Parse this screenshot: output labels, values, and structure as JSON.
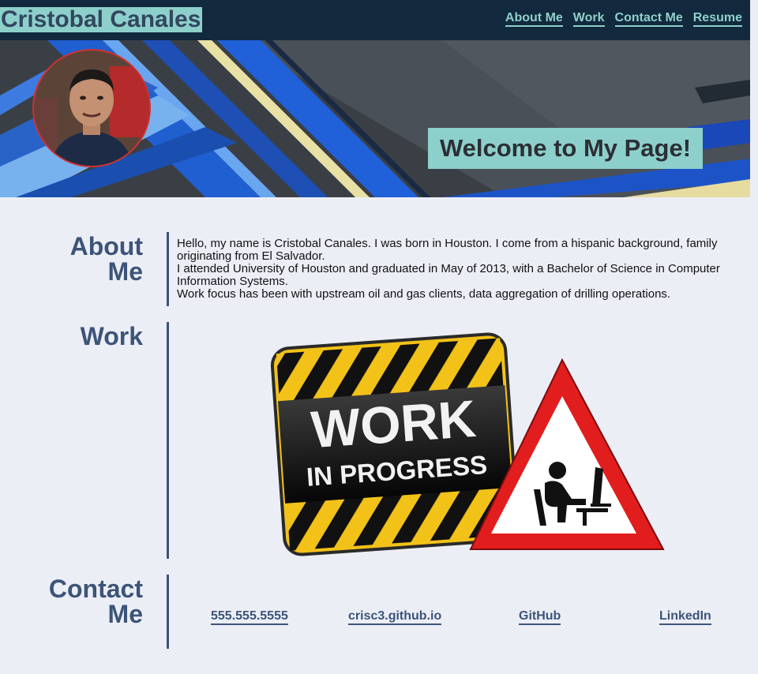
{
  "header": {
    "brand": "Cristobal Canales",
    "nav": [
      "About Me",
      "Work",
      "Contact Me",
      "Resume"
    ]
  },
  "hero": {
    "welcome": "Welcome to My Page!"
  },
  "about": {
    "title_line1": "About",
    "title_line2": "Me",
    "line1": "Hello, my name is Cristobal Canales. I was born in Houston. I come from a hispanic background, family originating from El Salvador.",
    "line2": "I attended University of Houston and graduated in May of 2013, with a Bachelor of Science in Computer Information Systems.",
    "line3": "Work focus has been with upstream oil and gas clients, data aggregation of drilling operations."
  },
  "work": {
    "title": "Work",
    "sign_line1": "WORK",
    "sign_line2": "IN PROGRESS"
  },
  "contact": {
    "title_line1": "Contact",
    "title_line2": "Me",
    "phone": "555.555.5555",
    "site": "crisc3.github.io",
    "github": "GitHub",
    "linkedin": "LinkedIn"
  },
  "colors": {
    "header_bg": "#13293d",
    "accent": "#8dd0cb",
    "heading": "#3c5478",
    "page_bg": "#eceef6"
  }
}
